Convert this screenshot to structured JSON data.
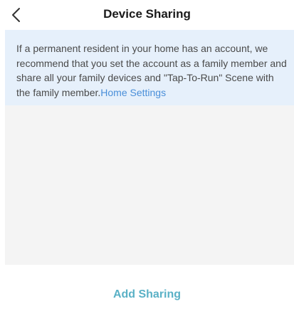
{
  "header": {
    "title": "Device Sharing",
    "back_icon": "chevron-left-icon"
  },
  "notice": {
    "text": "If a permanent resident in your home has an account, we recommend that you set the account as a family member and share all your family devices and \"Tap-To-Run\" Scene with the family member.",
    "link_label": "Home Settings",
    "link_color": "#4a8fd9",
    "background_color": "#e6f0fb"
  },
  "footer": {
    "add_label": "Add Sharing",
    "accent_color": "#5ab1c6"
  }
}
